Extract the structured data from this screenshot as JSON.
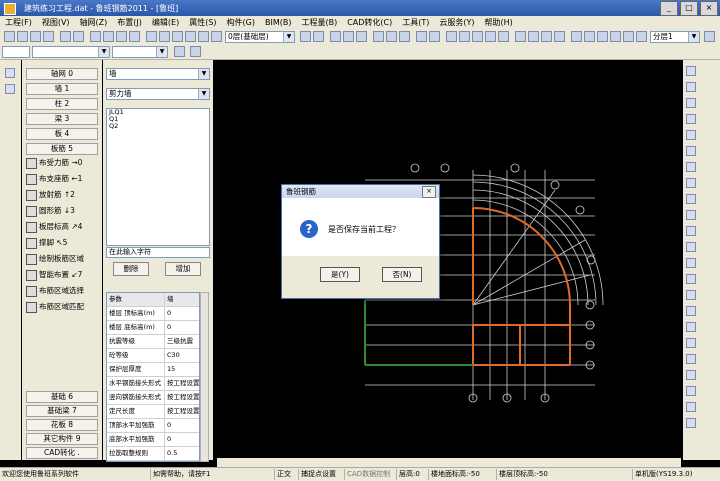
{
  "window": {
    "title": "建筑练习工程.dat - 鲁班钢筋2011 - [鲁班]",
    "buttons": [
      "_",
      "□",
      "×"
    ]
  },
  "menu": [
    "工程(F)",
    "视图(V)",
    "轴网(Z)",
    "布置(J)",
    "编辑(E)",
    "属性(S)",
    "构件(G)",
    "BIM(B)",
    "工程量(B)",
    "CAD转化(C)",
    "工具(T)",
    "云服务(Y)",
    "帮助(H)"
  ],
  "toolbar": {
    "floor_select": "0层(基础层)",
    "right_select": "分层1"
  },
  "left_panel": {
    "categories": [
      {
        "label": "轴网 0"
      },
      {
        "label": "墙 1"
      },
      {
        "label": "柱 2"
      },
      {
        "label": "梁 3"
      },
      {
        "label": "板 4"
      },
      {
        "label": "板筋 5"
      }
    ],
    "tools": [
      {
        "label": "布受力筋",
        "key": "→0"
      },
      {
        "label": "布支座筋",
        "key": "←1"
      },
      {
        "label": "放射筋",
        "key": "↑2"
      },
      {
        "label": "圆形筋",
        "key": "↓3"
      },
      {
        "label": "板层标高",
        "key": "↗4"
      },
      {
        "label": "撑脚",
        "key": "↖5"
      },
      {
        "label": "绘制板筋区域",
        "key": ""
      },
      {
        "label": "智能布置",
        "key": "↙7"
      },
      {
        "label": "布筋区域选择",
        "key": ""
      },
      {
        "label": "布筋区域匹配",
        "key": ""
      }
    ],
    "bottom_categories": [
      {
        "label": "基础 6"
      },
      {
        "label": "基础梁 7"
      },
      {
        "label": "花板 8"
      },
      {
        "label": "其它构件 9"
      },
      {
        "label": "CAD转化 ."
      }
    ]
  },
  "mid_panel": {
    "type_select": "墙",
    "subtype_select": "剪力墙",
    "list": [
      "JLQ1",
      "Q1",
      "Q2"
    ],
    "input_placeholder": "在此输入字符",
    "delete_label": "删除",
    "add_label": "增加",
    "props_header": {
      "k": "参数",
      "v": "墙"
    },
    "props": [
      {
        "k": "楼层 顶标高(m)",
        "v": "0"
      },
      {
        "k": "楼层 底标高(m)",
        "v": "0"
      },
      {
        "k": "抗震等级",
        "v": "三级抗震"
      },
      {
        "k": "砼等级",
        "v": "C30"
      },
      {
        "k": "保护层厚度",
        "v": "15"
      },
      {
        "k": "水平钢筋接头形式",
        "v": "按工程设置"
      },
      {
        "k": "竖向钢筋接头形式",
        "v": "按工程设置"
      },
      {
        "k": "定尺长度",
        "v": "按工程设置"
      },
      {
        "k": "顶部水平加强筋",
        "v": "0"
      },
      {
        "k": "底部水平加强筋",
        "v": "0"
      },
      {
        "k": "拉筋取整规则",
        "v": "0.5"
      }
    ]
  },
  "dialog": {
    "title": "鲁班钢筋",
    "message": "是否保存当前工程？",
    "yes": "是(Y)",
    "no": "否(N)",
    "close": "×"
  },
  "status": {
    "welcome": "欢迎您使用鲁班系列软件",
    "help": "如需帮助，请按F1",
    "ortho": "正交",
    "snap": "捕捉点设置",
    "cad": "CAD数据控制",
    "floor_height": "层高:0",
    "floor_bottom": "楼地面标高:-50",
    "floor_top": "楼层顶标高:-50",
    "version": "单机版(YS19.3.0)"
  },
  "colors": {
    "canvas": "#000000",
    "grid": "#d8d8d8",
    "beam": "#e06a28",
    "wall": "#2e8b2e"
  }
}
